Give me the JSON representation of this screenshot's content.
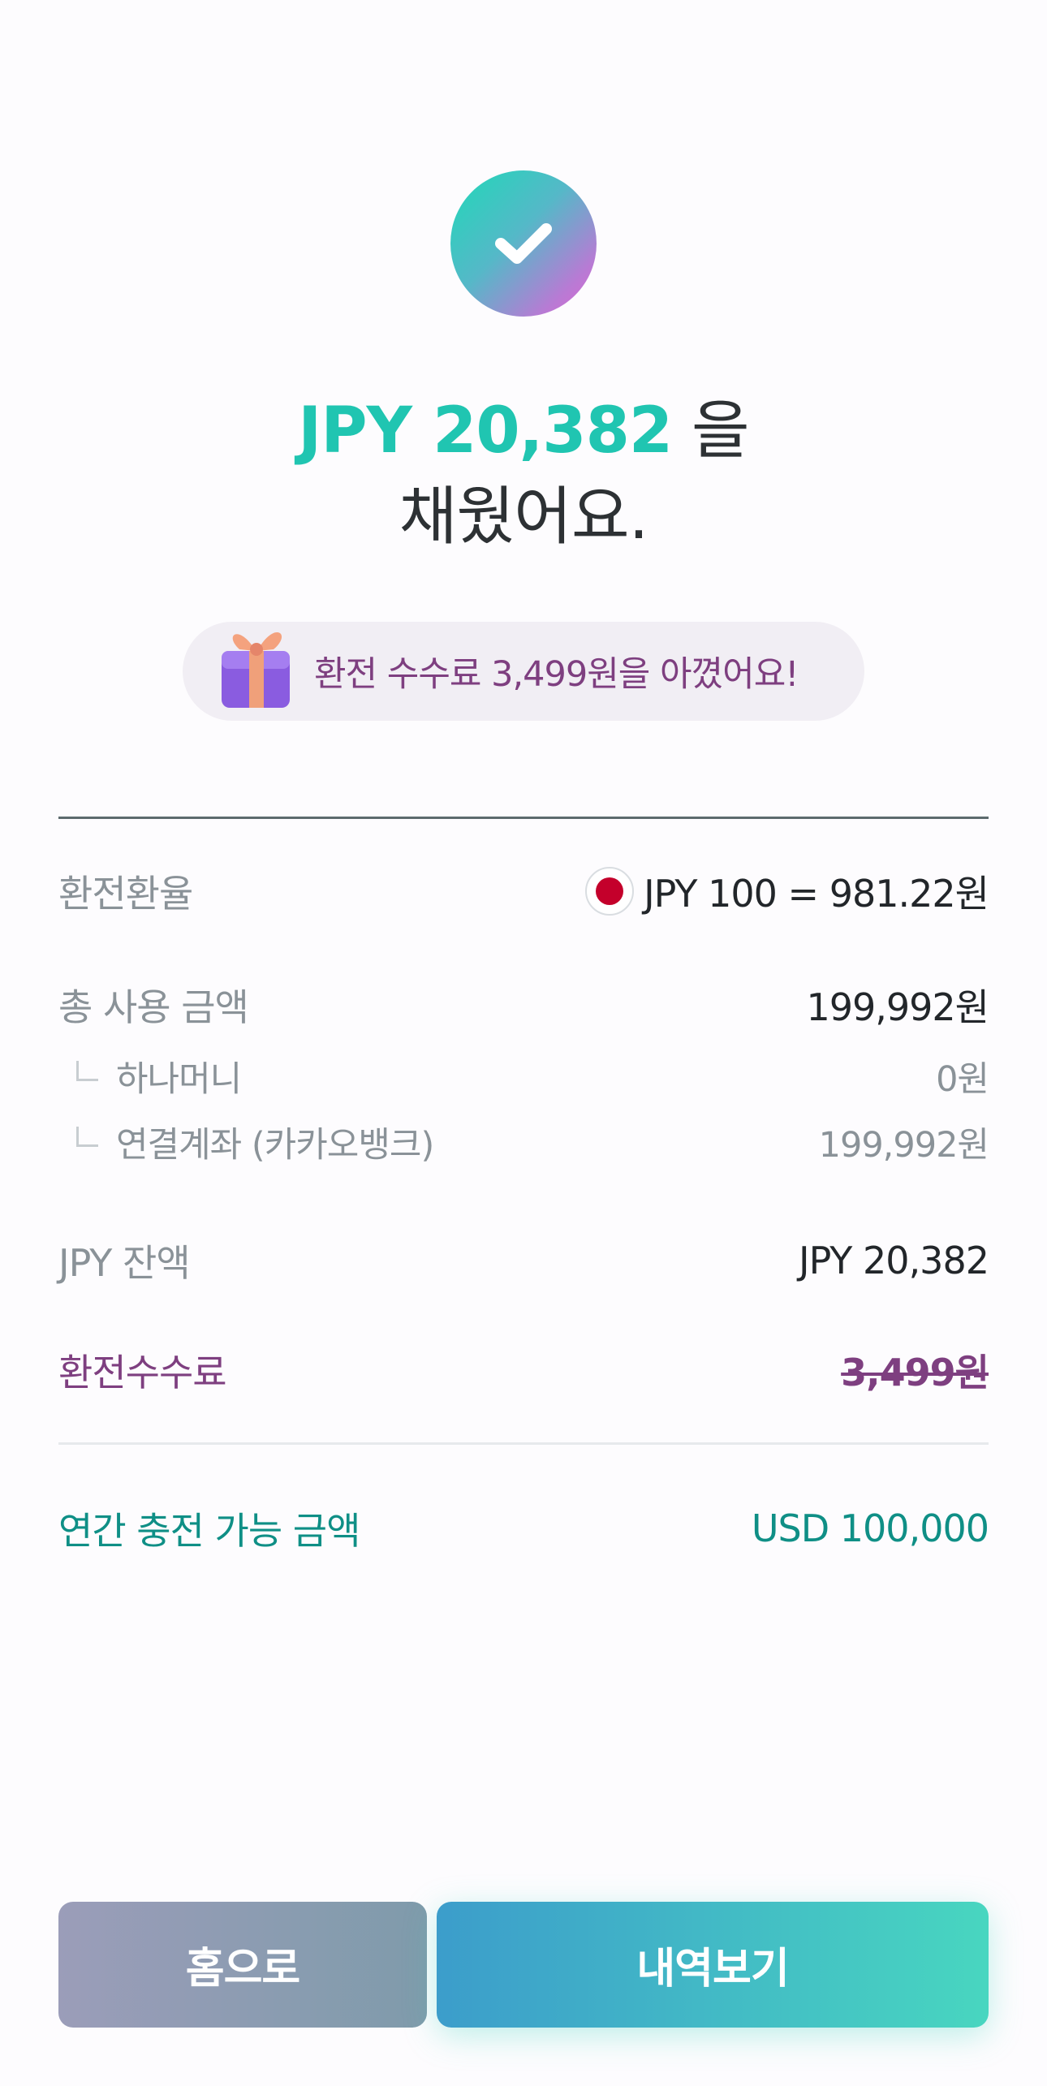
{
  "header": {
    "amount": "JPY 20,382",
    "particle": " 을",
    "line2": "채웠어요."
  },
  "savings_banner": {
    "text": "환전 수수료 3,499원을 아꼈어요!"
  },
  "details": {
    "exchange_rate": {
      "label": "환전환율",
      "value": "JPY 100 = 981.22원"
    },
    "total_used": {
      "label": "총 사용 금액",
      "value": "199,992원"
    },
    "hana_money": {
      "label": "하나머니",
      "value": "0원"
    },
    "linked_account": {
      "label": "연결계좌 (카카오뱅크)",
      "value": "199,992원"
    },
    "jpy_balance": {
      "label": "JPY 잔액",
      "value": "JPY 20,382"
    },
    "exchange_fee": {
      "label": "환전수수료",
      "value": "3,499원"
    },
    "annual_limit": {
      "label": "연간 충전 가능 금액",
      "value": "USD 100,000"
    }
  },
  "buttons": {
    "home": "홈으로",
    "history": "내역보기"
  },
  "icons": {
    "success": "check-icon",
    "gift": "gift-icon",
    "flag": "japan-flag-icon"
  },
  "colors": {
    "accent_teal": "#20c5b1",
    "fee_purple": "#7e3f80",
    "limit_teal": "#0f8f86"
  }
}
